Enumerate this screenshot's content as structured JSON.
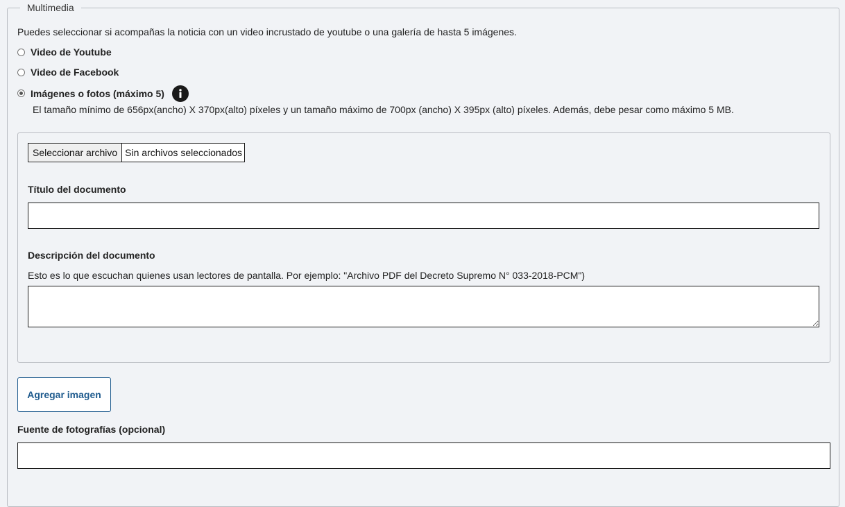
{
  "fieldset": {
    "legend": "Multimedia",
    "intro": "Puedes seleccionar si acompañas la noticia con un video incrustado de youtube o una galería de hasta 5 imágenes."
  },
  "options": [
    {
      "label": "Video de Youtube",
      "checked": false
    },
    {
      "label": "Video de Facebook",
      "checked": false
    },
    {
      "label": "Imágenes o fotos (máximo 5)",
      "checked": true
    }
  ],
  "images_hint": "El tamaño mínimo de 656px(ancho) X 370px(alto) píxeles y un tamaño máximo de 700px (ancho) X 395px (alto) píxeles. Además, debe pesar como máximo 5 MB.",
  "upload": {
    "button_label": "Seleccionar archivo",
    "status": "Sin archivos seleccionados"
  },
  "document": {
    "title_label": "Título del documento",
    "title_value": "",
    "description_label": "Descripción del documento",
    "description_help": "Esto es lo que escuchan quienes usan lectores de pantalla. Por ejemplo: \"Archivo PDF del Decreto Supremo N° 033-2018-PCM\")",
    "description_value": ""
  },
  "actions": {
    "add_image_label": "Agregar imagen"
  },
  "photo_source": {
    "label": "Fuente de fotografías (opcional)",
    "value": ""
  },
  "colors": {
    "background": "#f1f3f6",
    "border": "#b9bcc2",
    "accent": "#1f5b8e"
  },
  "icons": {
    "info": "info-icon"
  }
}
